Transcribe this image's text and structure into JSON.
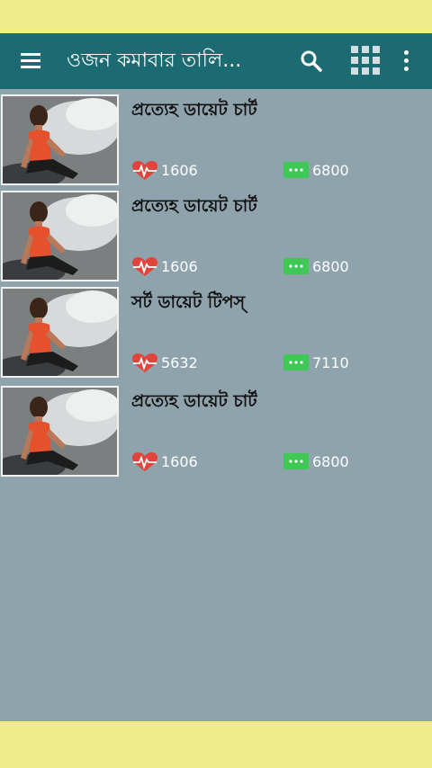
{
  "app_bar": {
    "title": "ওজন কমাবার তালি...",
    "menu_icon": "hamburger-menu-icon",
    "search_icon": "search-icon",
    "grid_icon": "apps-grid-icon",
    "more_icon": "more-vert-icon"
  },
  "colors": {
    "status_bar": "#f0ec8c",
    "app_bar": "#1c6b73",
    "background": "#8fa3ad",
    "heart": "#e0443a",
    "comment": "#3ec956",
    "nav_bar": "#f0ec8c"
  },
  "items": [
    {
      "title": "প্রত্যেহ ডায়েট চার্ট",
      "likes": "1606",
      "comments": "6800"
    },
    {
      "title": "প্রত্যেহ ডায়েট চার্ট",
      "likes": "1606",
      "comments": "6800"
    },
    {
      "title": "সর্ট ডায়েট টিপস্",
      "likes": "5632",
      "comments": "7110"
    },
    {
      "title": "প্রত্যেহ ডায়েট চার্ট",
      "likes": "1606",
      "comments": "6800"
    }
  ]
}
